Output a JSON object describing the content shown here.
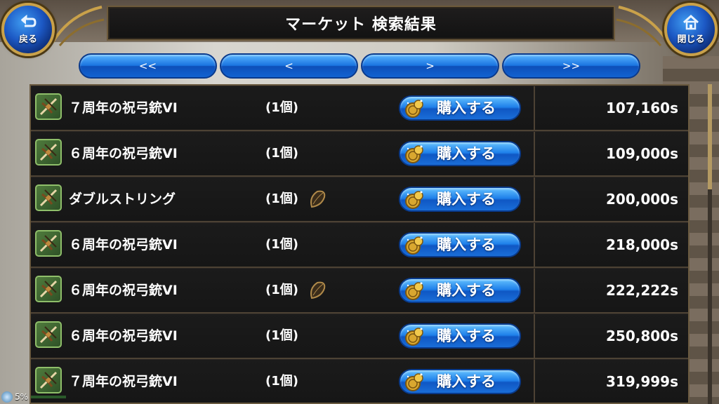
{
  "header": {
    "title": "マーケット 検索結果",
    "back_label": "戻る",
    "close_label": "閉じる"
  },
  "pager": {
    "first": "<<",
    "prev": "<",
    "next": ">",
    "last": ">>"
  },
  "listings": [
    {
      "name": "７周年の祝弓銃VI",
      "qty": "(1個)",
      "seed": false,
      "buy": "購入する",
      "price": "107,160s"
    },
    {
      "name": "６周年の祝弓銃VI",
      "qty": "(1個)",
      "seed": false,
      "buy": "購入する",
      "price": "109,000s"
    },
    {
      "name": "ダブルストリング",
      "qty": "(1個)",
      "seed": true,
      "buy": "購入する",
      "price": "200,000s"
    },
    {
      "name": "６周年の祝弓銃VI",
      "qty": "(1個)",
      "seed": false,
      "buy": "購入する",
      "price": "218,000s"
    },
    {
      "name": "６周年の祝弓銃VI",
      "qty": "(1個)",
      "seed": true,
      "buy": "購入する",
      "price": "222,222s"
    },
    {
      "name": "６周年の祝弓銃VI",
      "qty": "(1個)",
      "seed": false,
      "buy": "購入する",
      "price": "250,800s"
    },
    {
      "name": "７周年の祝弓銃VI",
      "qty": "(1個)",
      "seed": false,
      "buy": "購入する",
      "price": "319,999s"
    }
  ],
  "status": {
    "battery": "5%"
  },
  "icons": {
    "back": "undo-arrow-icon",
    "close": "home-icon",
    "item": "crossbow-icon",
    "coin": "coin-icon",
    "seed": "seed-icon"
  },
  "colors": {
    "button_blue": "#1f80ea",
    "row_bg": "#1b1b1b",
    "frame_gold": "#c9a14a"
  }
}
